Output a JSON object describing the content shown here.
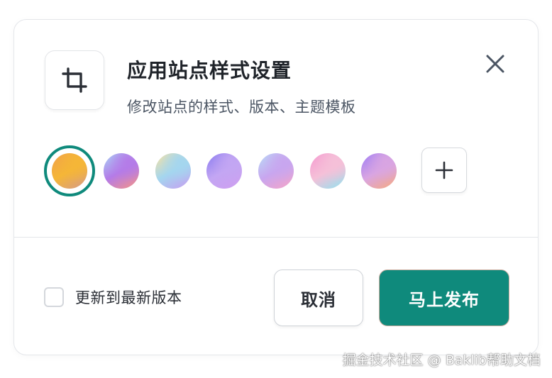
{
  "dialog": {
    "title": "应用站点样式设置",
    "subtitle": "修改站点的样式、版本、主题模板",
    "icon": "crop-icon",
    "close_icon": "close-icon"
  },
  "swatches": {
    "selected_index": 0,
    "accent_color": "#0f8a7c",
    "items": [
      {
        "name": "orange-gold",
        "colors": [
          "#f0a04c",
          "#f5b637",
          "#d59a8a"
        ]
      },
      {
        "name": "blue-purple-coral",
        "colors": [
          "#a9d4f5",
          "#b47be8",
          "#f79483"
        ]
      },
      {
        "name": "yellow-purple",
        "colors": [
          "#f9e2a1",
          "#a4d6ef",
          "#c79df0"
        ]
      },
      {
        "name": "indigo-lilac",
        "colors": [
          "#8a7cf0",
          "#c3a6f3",
          "#cf9ef0"
        ]
      },
      {
        "name": "skyblue-pink",
        "colors": [
          "#b9dcf7",
          "#c8a6ef",
          "#f7a4c6"
        ]
      },
      {
        "name": "pink-cyan",
        "colors": [
          "#f59ad0",
          "#f5c0d8",
          "#8fe3f0"
        ]
      },
      {
        "name": "purple-peach",
        "colors": [
          "#9d7df5",
          "#d9a5e2",
          "#f7a97c"
        ]
      }
    ],
    "add_icon": "plus-icon"
  },
  "footer": {
    "checkbox_label": "更新到最新版本",
    "checkbox_checked": false,
    "cancel_label": "取消",
    "publish_label": "马上发布",
    "publish_color": "#0f8a7c"
  },
  "watermark": "掘金技术社区 @ Baklib帮助文档"
}
